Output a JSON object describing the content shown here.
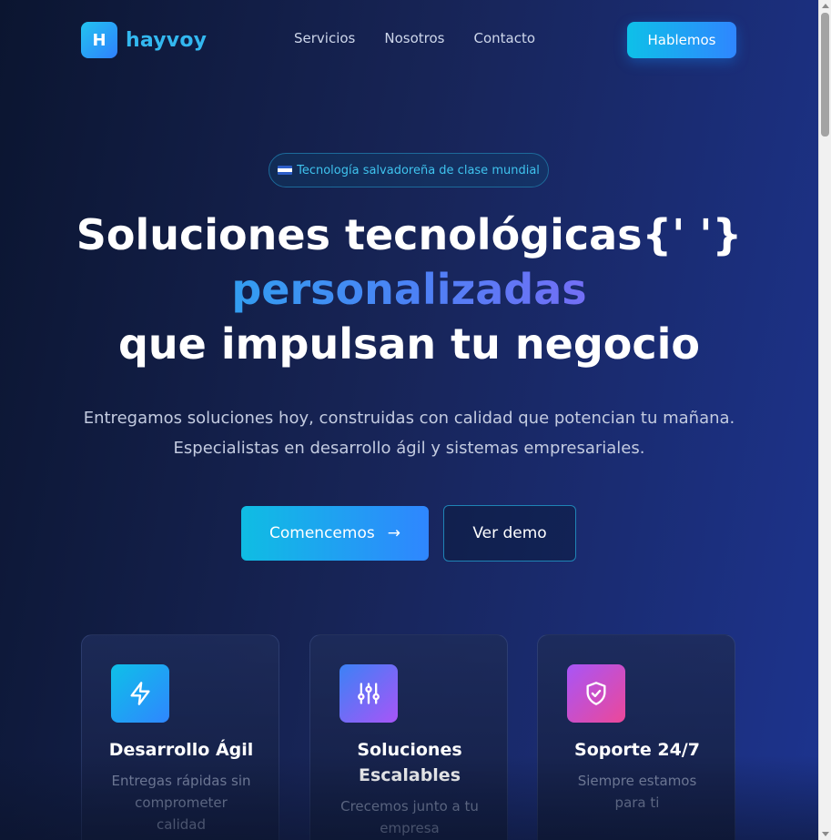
{
  "brand": {
    "logo_letter": "H",
    "name": "hayvoy"
  },
  "nav": {
    "items": [
      "Servicios",
      "Nosotros",
      "Contacto"
    ]
  },
  "header": {
    "cta_label": "Hablemos"
  },
  "hero": {
    "badge_text": "Tecnología salvadoreña de clase mundial",
    "headline_line1": "Soluciones tecnológicas{' '}",
    "headline_line2": "personalizadas",
    "headline_line3": "que impulsan tu negocio",
    "subtitle_line1": "Entregamos soluciones hoy, construidas con calidad que potencian tu mañana.",
    "subtitle_line2": "Especialistas en desarrollo ágil y sistemas empresariales.",
    "primary_label": "Comencemos",
    "primary_arrow": "→",
    "secondary_label": "Ver demo"
  },
  "features": [
    {
      "title": "Desarrollo Ágil",
      "description": "Entregas rápidas sin comprometer calidad",
      "icon": "lightning-icon"
    },
    {
      "title": "Soluciones Escalables",
      "description": "Crecemos junto a tu empresa",
      "icon": "sliders-icon"
    },
    {
      "title": "Soporte 24/7",
      "description": "Siempre estamos para ti",
      "icon": "shield-check-icon"
    }
  ],
  "colors": {
    "accent_cyan": "#0ec0e8",
    "accent_blue": "#2f86ff",
    "accent_purple": "#a855f7",
    "accent_pink": "#ec4899"
  }
}
